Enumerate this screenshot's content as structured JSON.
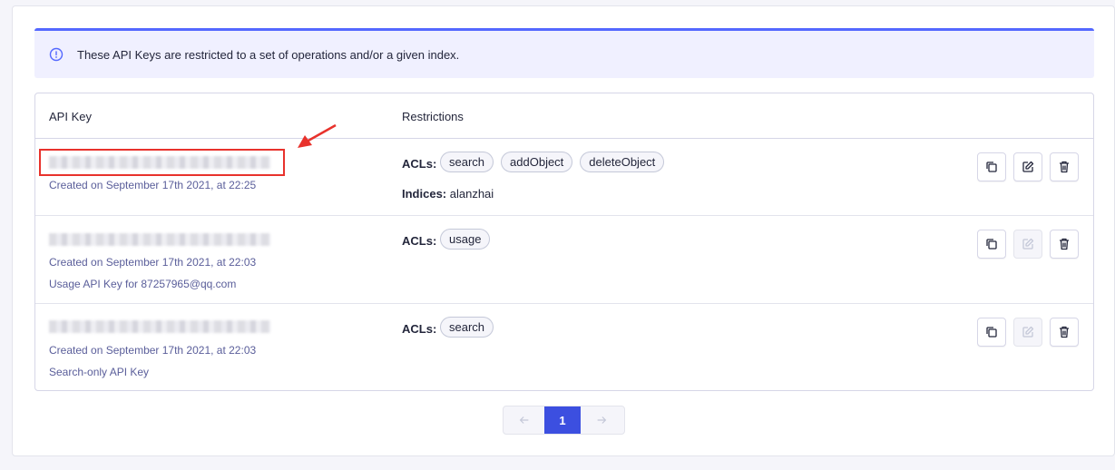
{
  "notice": {
    "text": "These API Keys are restricted to a set of operations and/or a given index."
  },
  "table": {
    "headers": {
      "api_key": "API Key",
      "restrictions": "Restrictions"
    },
    "rows": [
      {
        "created": "Created on September 17th 2021, at 22:25",
        "description": "",
        "acls_label": "ACLs:",
        "acls": [
          "search",
          "addObject",
          "deleteObject"
        ],
        "indices_label": "Indices:",
        "indices": "alanzhai",
        "edit_enabled": true
      },
      {
        "created": "Created on September 17th 2021, at 22:03",
        "description": "Usage API Key for 87257965@qq.com",
        "acls_label": "ACLs:",
        "acls": [
          "usage"
        ],
        "edit_enabled": false
      },
      {
        "created": "Created on September 17th 2021, at 22:03",
        "description": "Search-only API Key",
        "acls_label": "ACLs:",
        "acls": [
          "search"
        ],
        "edit_enabled": false
      }
    ]
  },
  "pagination": {
    "current_page": "1"
  },
  "colors": {
    "accent": "#5468ff",
    "annotation": "#e8322c",
    "page_active": "#3c4fe0"
  }
}
